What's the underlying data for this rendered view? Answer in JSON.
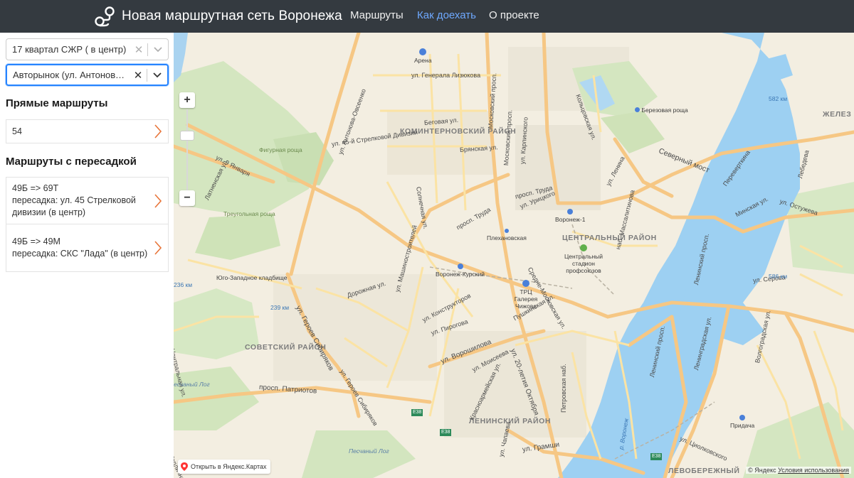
{
  "navbar": {
    "brand": "Новая маршрутная сеть Воронежа",
    "links": [
      {
        "label": "Маршруты",
        "active": false
      },
      {
        "label": "Как доехать",
        "active": true
      },
      {
        "label": "О проекте",
        "active": false
      }
    ],
    "active_color": "#6ea8fe",
    "background": "#343a40"
  },
  "sidebar": {
    "from": {
      "value": "17 квартал СЖР ( в центр)",
      "clear_icon": "close-icon",
      "arrow_icon": "chevron-down-icon"
    },
    "to": {
      "value": "Авторынок (ул. Антонова-Овсеенко)",
      "clear_icon": "close-icon",
      "arrow_icon": "chevron-down-icon"
    },
    "direct_title": "Прямые маршруты",
    "direct_routes": [
      {
        "label": "54"
      }
    ],
    "transfer_title": "Маршруты с пересадкой",
    "transfer_routes": [
      {
        "route": "49Б => 69Т",
        "transfer": "пересадка: ул. 45 Стрелковой дивизии (в центр)"
      },
      {
        "route": "49Б => 49М",
        "transfer": "пересадка: СКС \"Лада\" (в центр)"
      }
    ],
    "accent_color": "#e8753a"
  },
  "map": {
    "zoom_in": "+",
    "zoom_out": "−",
    "open_link": "Открыть в Яндекс.Картах",
    "copyright": "© Яндекс",
    "terms": "Условия использования",
    "districts": [
      "КОМИНТЕРНОВСКИЙ РАЙОН",
      "ЦЕНТРАЛЬНЫЙ РАЙОН",
      "СОВЕТСКИЙ РАЙОН",
      "ЛЕНИНСКИЙ РАЙОН",
      "ЛЕВОБЕРЕЖНЫЙ",
      "ЖЕЛЕЗ"
    ],
    "streets": [
      "ул. Антонова-Овсеенко",
      "ул. 9 Января",
      "Московский просп.",
      "Московский просп.",
      "ул. Генерала Лизюкова",
      "Беговая ул.",
      "ул. 45-й Стрелковой Дивизии",
      "Брянская ул.",
      "ул. Карпинского",
      "Северный мост",
      "ул. Ленина",
      "ул. Остужева",
      "просп. Труда",
      "просп. Труда",
      "ул. Урицкого",
      "ул. Героев Сибиряков",
      "ул. Машиностроителей",
      "ул. Конструкторов",
      "ул. Пирогова",
      "ул. Ворошилова",
      "ул. Моисеева",
      "ул. 20-летия Октября",
      "просп. Патриотов",
      "ул. Героев Сибиряков",
      "ул. Грамши",
      "Ленинский просп.",
      "Ленинский просп.",
      "ул. Серова",
      "Пушкинская ул.",
      "Дорожная ул.",
      "Солнечная ул.",
      "Минская ул.",
      "ул. Циолковского",
      "Переверткина",
      "Лебедева",
      "ул. Чапаева",
      "Красноармейская ул.",
      "Петровская наб.",
      "наб. Массалитинова",
      "Средне-Московская ул.",
      "Латненская ул.",
      "Волгоградская ул.",
      "Ленинградская ул.",
      "Тепличная ул.",
      "Центральная ул.",
      "Кольцовская ул."
    ],
    "pois": [
      "Арена",
      "Березовая роща",
      "Фигурная роща",
      "Треугольная роща",
      "Юго-Западное кладбище",
      "Воронеж-1",
      "Плехановская",
      "Воронеж-Курский",
      "ТРЦ Галерея Чижова",
      "Центральный стадион профсоюзов",
      "Придача",
      "Песчаный Лог",
      "Песчаный Лог",
      "р. Воронеж"
    ],
    "km_marks": [
      "582 км",
      "586 км",
      "236 км",
      "239 км"
    ],
    "road_marks": [
      "E38",
      "E38",
      "E38"
    ]
  }
}
